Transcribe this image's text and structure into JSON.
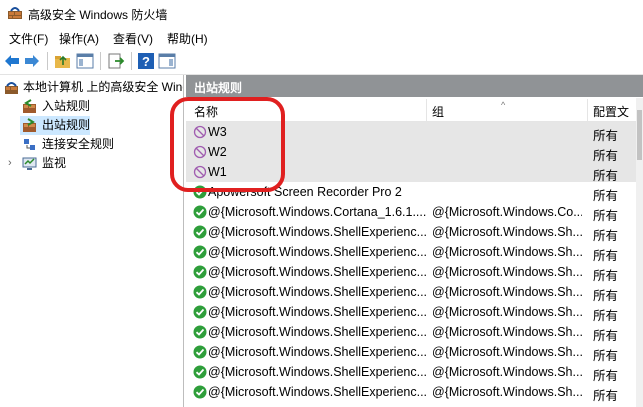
{
  "window": {
    "title": "高级安全 Windows 防火墙"
  },
  "menu": [
    {
      "label": "文件(F)"
    },
    {
      "label": "操作(A)"
    },
    {
      "label": "查看(V)"
    },
    {
      "label": "帮助(H)"
    }
  ],
  "toolbar": {
    "icons": [
      "back-arrow-icon",
      "forward-arrow-icon",
      "folder-up-icon",
      "show-hide-tree-icon",
      "export-icon",
      "help-icon",
      "properties-pane-icon"
    ]
  },
  "tree": {
    "root": "本地计算机 上的高级安全 Wind",
    "items": [
      {
        "label": "入站规则"
      },
      {
        "label": "出站规则"
      },
      {
        "label": "连接安全规则"
      },
      {
        "label": "监视"
      }
    ]
  },
  "pane": {
    "header": "出站规则",
    "columns": [
      "名称",
      "组",
      "配置文件"
    ],
    "rows": [
      {
        "name": "W3",
        "group": "",
        "profile": "所有",
        "status": "disabled"
      },
      {
        "name": "W2",
        "group": "",
        "profile": "所有",
        "status": "disabled"
      },
      {
        "name": "W1",
        "group": "",
        "profile": "所有",
        "status": "disabled"
      },
      {
        "name": "Apowersoft Screen Recorder Pro 2",
        "group": "",
        "profile": "所有",
        "status": "enabled"
      },
      {
        "name": "@{Microsoft.Windows.Cortana_1.6.1....",
        "group": "@{Microsoft.Windows.Co...",
        "profile": "所有",
        "status": "enabled"
      },
      {
        "name": "@{Microsoft.Windows.ShellExperienc...",
        "group": "@{Microsoft.Windows.Sh...",
        "profile": "所有",
        "status": "enabled"
      },
      {
        "name": "@{Microsoft.Windows.ShellExperienc...",
        "group": "@{Microsoft.Windows.Sh...",
        "profile": "所有",
        "status": "enabled"
      },
      {
        "name": "@{Microsoft.Windows.ShellExperienc...",
        "group": "@{Microsoft.Windows.Sh...",
        "profile": "所有",
        "status": "enabled"
      },
      {
        "name": "@{Microsoft.Windows.ShellExperienc...",
        "group": "@{Microsoft.Windows.Sh...",
        "profile": "所有",
        "status": "enabled"
      },
      {
        "name": "@{Microsoft.Windows.ShellExperienc...",
        "group": "@{Microsoft.Windows.Sh...",
        "profile": "所有",
        "status": "enabled"
      },
      {
        "name": "@{Microsoft.Windows.ShellExperienc...",
        "group": "@{Microsoft.Windows.Sh...",
        "profile": "所有",
        "status": "enabled"
      },
      {
        "name": "@{Microsoft.Windows.ShellExperienc...",
        "group": "@{Microsoft.Windows.Sh...",
        "profile": "所有",
        "status": "enabled"
      },
      {
        "name": "@{Microsoft.Windows.ShellExperienc...",
        "group": "@{Microsoft.Windows.Sh...",
        "profile": "所有",
        "status": "enabled"
      },
      {
        "name": "@{Microsoft.Windows.ShellExperienc...",
        "group": "@{Microsoft.Windows.Sh...",
        "profile": "所有",
        "status": "enabled"
      }
    ]
  },
  "colors": {
    "enabled": "#2e9e3a",
    "disabled": "#a05db0",
    "header_bg": "#909396",
    "selection": "#cce8ff",
    "annotation": "#e02020"
  }
}
